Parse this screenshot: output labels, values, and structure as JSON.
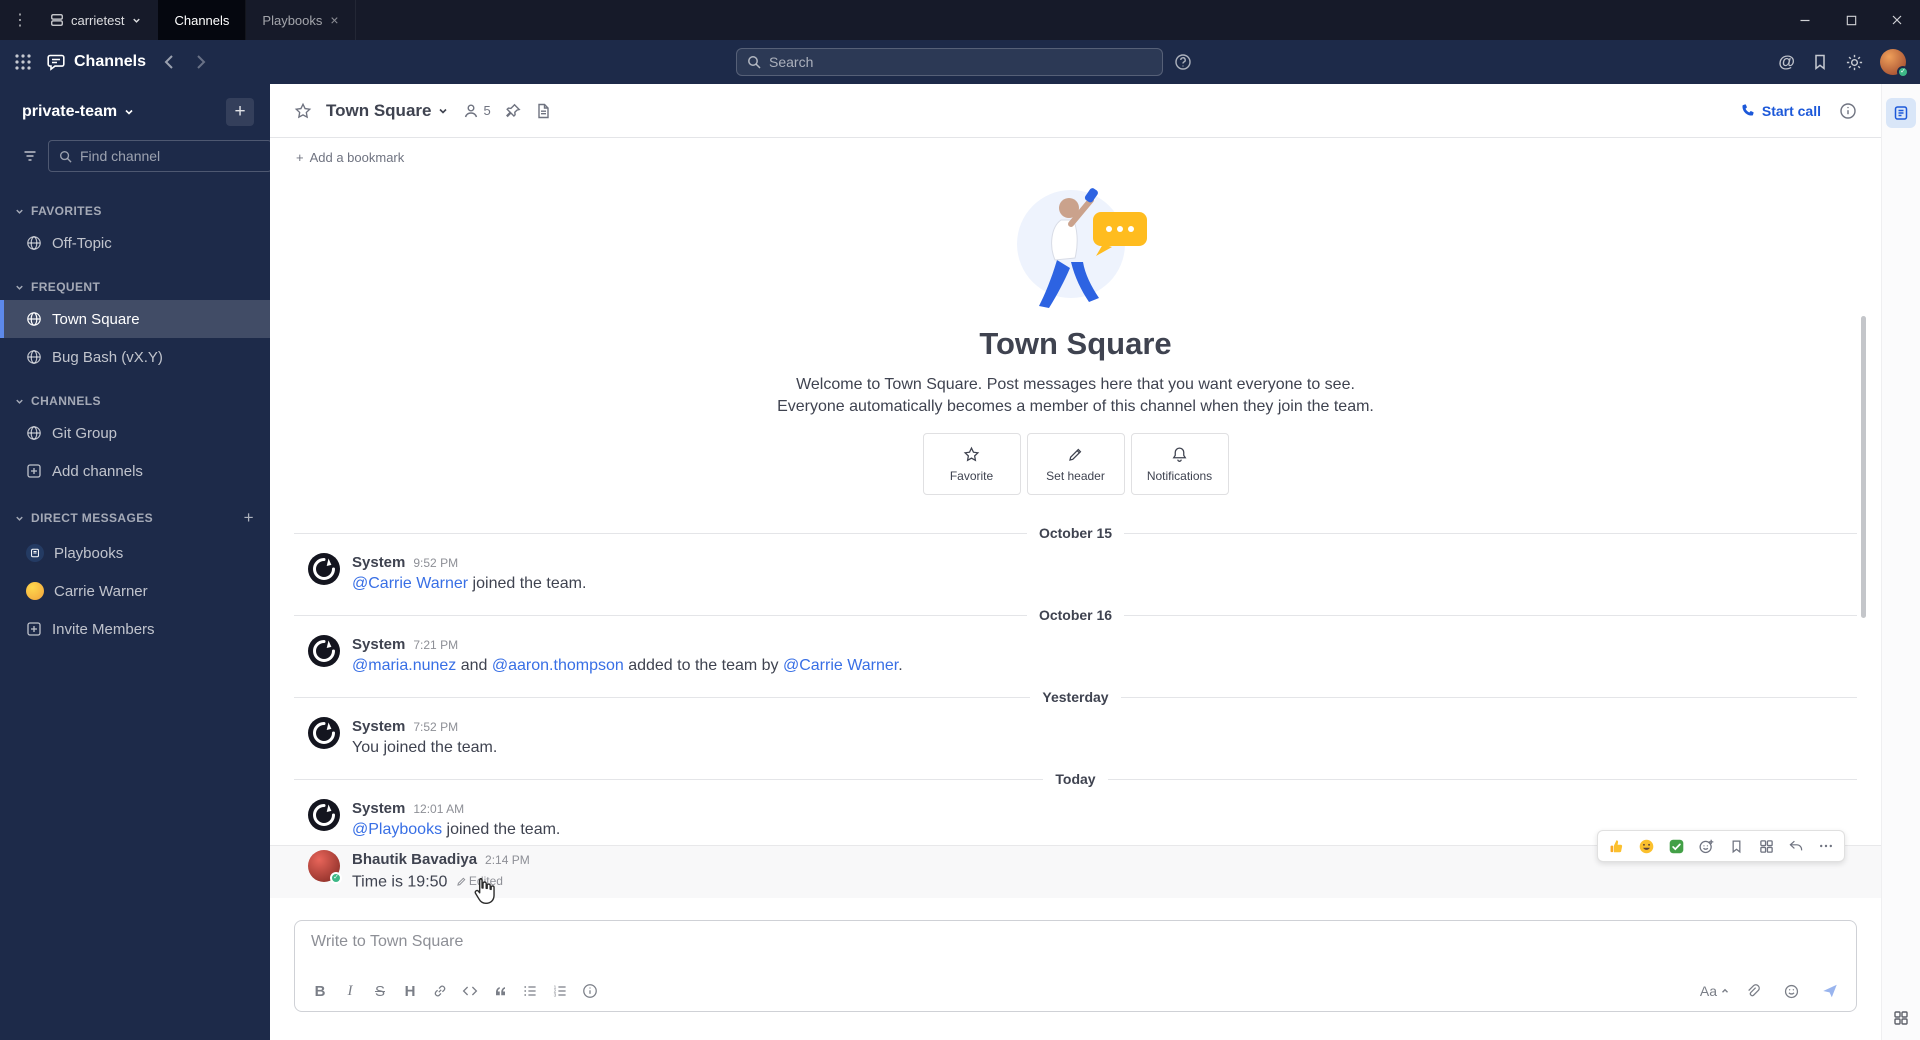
{
  "colors": {
    "accent": "#1c58d9",
    "link": "#386fe5",
    "online_green": "#3db887",
    "sidebar_bg": "#1d2a49",
    "titlebar_bg": "#161a29"
  },
  "titlebar": {
    "server_name": "carrietest",
    "tabs": [
      {
        "label": "Channels"
      },
      {
        "label": "Playbooks"
      }
    ]
  },
  "global_header": {
    "product_name": "Channels",
    "search_placeholder": "Search"
  },
  "sidebar": {
    "team_name": "private-team",
    "find_channel_placeholder": "Find channel",
    "sections": [
      {
        "label": "FAVORITES",
        "items": [
          {
            "label": "Off-Topic"
          }
        ]
      },
      {
        "label": "FREQUENT",
        "items": [
          {
            "label": "Town Square"
          },
          {
            "label": "Bug Bash (vX.Y)"
          }
        ]
      },
      {
        "label": "CHANNELS",
        "items": [
          {
            "label": "Git Group"
          },
          {
            "label": "Add channels"
          }
        ]
      },
      {
        "label": "DIRECT MESSAGES",
        "items": [
          {
            "label": "Playbooks"
          },
          {
            "label": "Carrie Warner"
          },
          {
            "label": "Invite Members"
          }
        ]
      }
    ]
  },
  "channel_header": {
    "name": "Town Square",
    "member_count": "5",
    "start_call_label": "Start call"
  },
  "bookmark_bar": {
    "add_label": "Add a bookmark"
  },
  "intro": {
    "title": "Town Square",
    "description": "Welcome to Town Square. Post messages here that you want everyone to see. Everyone automatically becomes a member of this channel when they join the team.",
    "actions": [
      {
        "label": "Favorite"
      },
      {
        "label": "Set header"
      },
      {
        "label": "Notifications"
      }
    ]
  },
  "timeline": [
    {
      "type": "divider",
      "label": "October 15"
    },
    {
      "type": "system",
      "sender": "System",
      "time": "9:52 PM",
      "parts": [
        {
          "t": "@Carrie Warner",
          "link": true
        },
        {
          "t": " joined the team."
        }
      ]
    },
    {
      "type": "divider",
      "label": "October 16"
    },
    {
      "type": "system",
      "sender": "System",
      "time": "7:21 PM",
      "parts": [
        {
          "t": "@maria.nunez",
          "link": true
        },
        {
          "t": " and "
        },
        {
          "t": "@aaron.thompson",
          "link": true
        },
        {
          "t": " added to the team by "
        },
        {
          "t": "@Carrie Warner",
          "link": true
        },
        {
          "t": "."
        }
      ]
    },
    {
      "type": "divider",
      "label": "Yesterday"
    },
    {
      "type": "system",
      "sender": "System",
      "time": "7:52 PM",
      "parts": [
        {
          "t": "You joined the team."
        }
      ]
    },
    {
      "type": "divider",
      "label": "Today"
    },
    {
      "type": "system",
      "sender": "System",
      "time": "12:01 AM",
      "parts": [
        {
          "t": "@Playbooks",
          "link": true
        },
        {
          "t": " joined the team."
        }
      ]
    },
    {
      "type": "user",
      "sender": "Bhautik Bavadiya",
      "time": "2:14 PM",
      "parts": [
        {
          "t": "Time is 19:50"
        }
      ],
      "edited_label": "Edited"
    }
  ],
  "hover_toolbar": {
    "reactions": [
      "thumbsup",
      "smile",
      "white_check_mark"
    ],
    "action_icons": [
      "add-reaction",
      "save-message",
      "message-actions",
      "reply",
      "more-actions"
    ]
  },
  "composer": {
    "placeholder": "Write to Town Square",
    "bold": "B",
    "italic": "I",
    "strike": "S",
    "heading": "H",
    "format_toggle": "Aa"
  }
}
